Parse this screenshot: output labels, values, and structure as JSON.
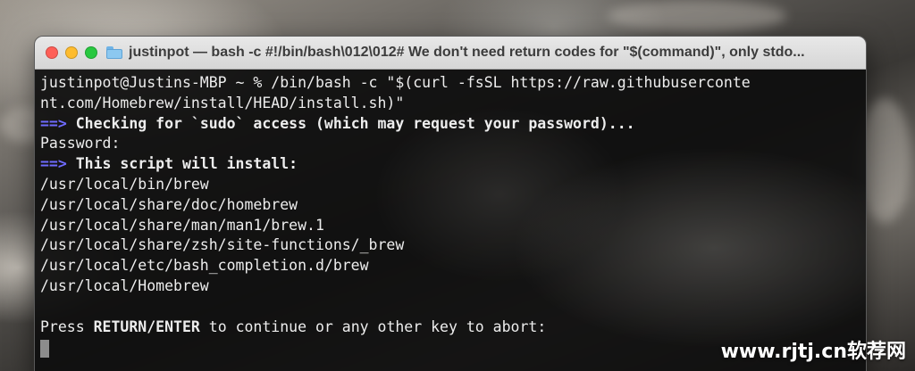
{
  "window": {
    "title": "justinpot — bash -c #!/bin/bash\\012\\012# We don't need return codes for \"$(command)\", only stdo..."
  },
  "terminal": {
    "lines": [
      "justinpot@Justins-MBP ~ % /bin/bash -c \"$(curl -fsSL https://raw.githubuserconte",
      "nt.com/Homebrew/install/HEAD/install.sh)\"",
      "Checking for `sudo` access (which may request your password)...",
      "Password:",
      "This script will install:",
      "/usr/local/bin/brew",
      "/usr/local/share/doc/homebrew",
      "/usr/local/share/man/man1/brew.1",
      "/usr/local/share/zsh/site-functions/_brew",
      "/usr/local/etc/bash_completion.d/brew",
      "/usr/local/Homebrew",
      "",
      "Press ",
      "RETURN/ENTER",
      " to continue or any other key to abort:"
    ],
    "prompt_arrow": "==>"
  },
  "watermark": "www.rjtj.cn软荐网",
  "colors": {
    "arrow": "#6f6bff",
    "text": "#ededed",
    "titlebar": "#e0e0e0",
    "terminal_bg": "#0e0e0e"
  }
}
